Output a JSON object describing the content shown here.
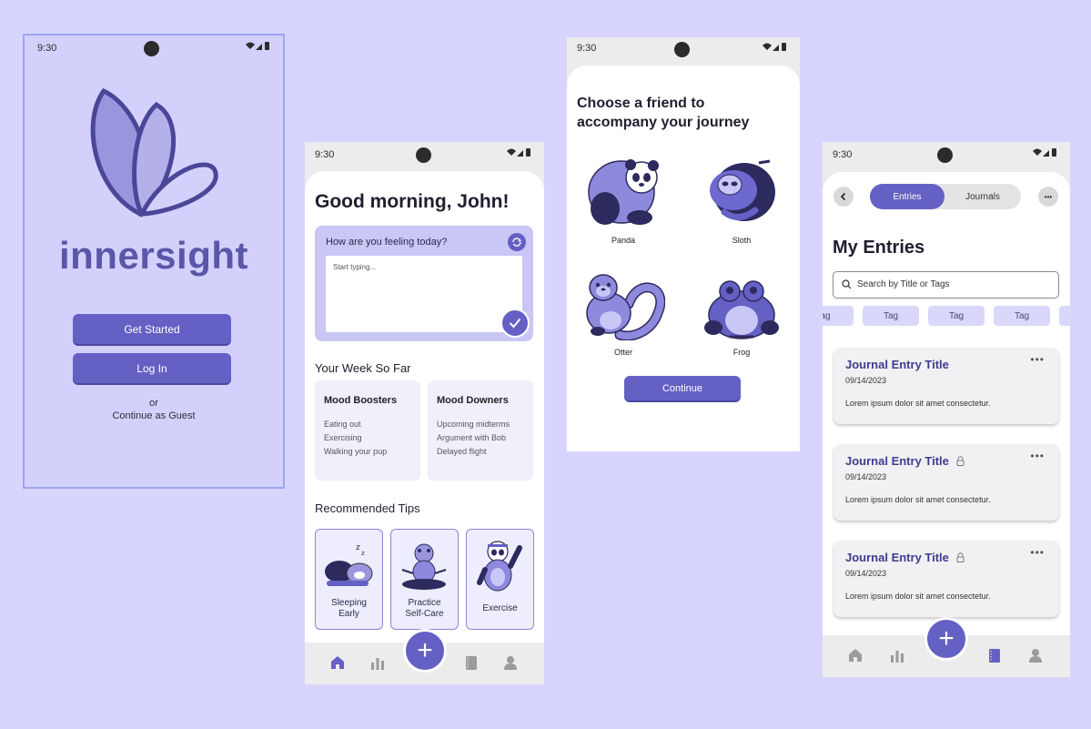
{
  "colors": {
    "background": "#d7d5fd",
    "accent": "#6560c4",
    "accent_light": "#c9c7f6"
  },
  "statusbar": {
    "time": "9:30"
  },
  "splash": {
    "brand": "innersight",
    "get_started": "Get Started",
    "login": "Log In",
    "or": "or",
    "guest": "Continue as Guest"
  },
  "home": {
    "greeting": "Good morning, John!",
    "mood_prompt": "How are you feeling today?",
    "mood_placeholder": "Start typing...",
    "week_title": "Your Week So Far",
    "boosters": {
      "title": "Mood Boosters",
      "items": [
        "Eating out",
        "Exercising",
        "Walking your pup"
      ]
    },
    "downers": {
      "title": "Mood Downers",
      "items": [
        "Upcoming midterms",
        "Argument with Bob",
        "Delayed flight"
      ]
    },
    "tips_title": "Recommended Tips",
    "tips": [
      {
        "line1": "Sleeping",
        "line2": "Early"
      },
      {
        "line1": "Practice",
        "line2": "Self-Care"
      },
      {
        "line1": "Exercise",
        "line2": ""
      }
    ]
  },
  "friend": {
    "title_line1": "Choose a friend to",
    "title_line2": "accompany your journey",
    "animals": [
      "Panda",
      "Sloth",
      "Otter",
      "Frog"
    ],
    "continue": "Continue"
  },
  "entries": {
    "tab_entries": "Entries",
    "tab_journals": "Journals",
    "title": "My Entries",
    "search_placeholder": "Search by Title or Tags",
    "tags": [
      "ag",
      "Tag",
      "Tag",
      "Tag"
    ],
    "items": [
      {
        "title": "Journal Entry Title",
        "date": "09/14/2023",
        "excerpt": "Lorem ipsum dolor sit amet consectetur.",
        "locked": false
      },
      {
        "title": "Journal Entry Title",
        "date": "09/14/2023",
        "excerpt": "Lorem ipsum dolor sit amet consectetur.",
        "locked": true
      },
      {
        "title": "Journal Entry Title",
        "date": "09/14/2023",
        "excerpt": "Lorem ipsum dolor sit amet consectetur.",
        "locked": true
      }
    ]
  },
  "icons": {
    "fab": "+",
    "more": "•••",
    "nav": [
      "home-icon",
      "chart-icon",
      "journal-icon",
      "profile-icon"
    ]
  }
}
